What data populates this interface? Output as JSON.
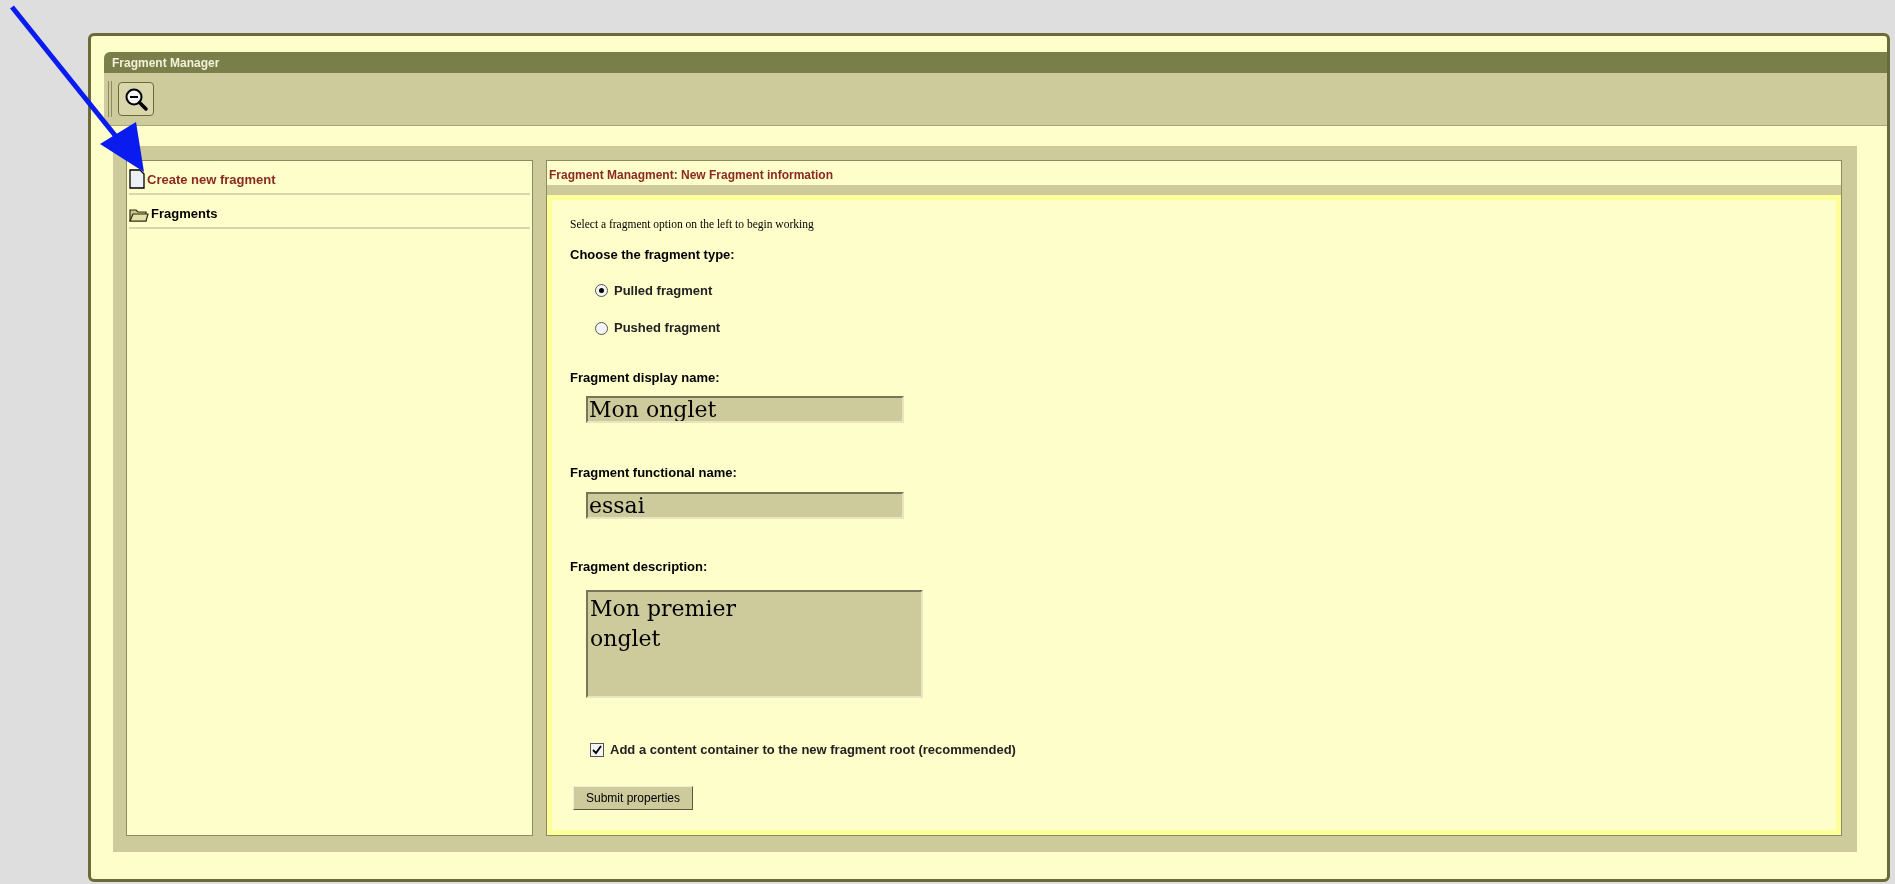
{
  "window": {
    "title": "Fragment Manager"
  },
  "sidebar": {
    "items": [
      {
        "label": "Create new fragment",
        "kind": "document",
        "selected": true
      },
      {
        "label": "Fragments",
        "kind": "folder",
        "selected": false
      }
    ]
  },
  "panel": {
    "title": "Fragment Managment: New Fragment information",
    "intro": "Select a fragment option on the left to begin working",
    "type_label": "Choose the fragment type:",
    "type_options": [
      {
        "label": "Pulled fragment",
        "selected": true
      },
      {
        "label": "Pushed fragment",
        "selected": false
      }
    ],
    "fields": [
      {
        "kind": "input",
        "label": "Fragment display name:",
        "value": "Mon onglet"
      },
      {
        "kind": "input",
        "label": "Fragment functional name:",
        "value": "essai"
      },
      {
        "kind": "textarea",
        "label": "Fragment description:",
        "value": "Mon premier\nonglet"
      }
    ],
    "checkbox": {
      "label": "Add a content container to the new fragment root (recommended)",
      "checked": true
    },
    "submit": "Submit properties"
  }
}
